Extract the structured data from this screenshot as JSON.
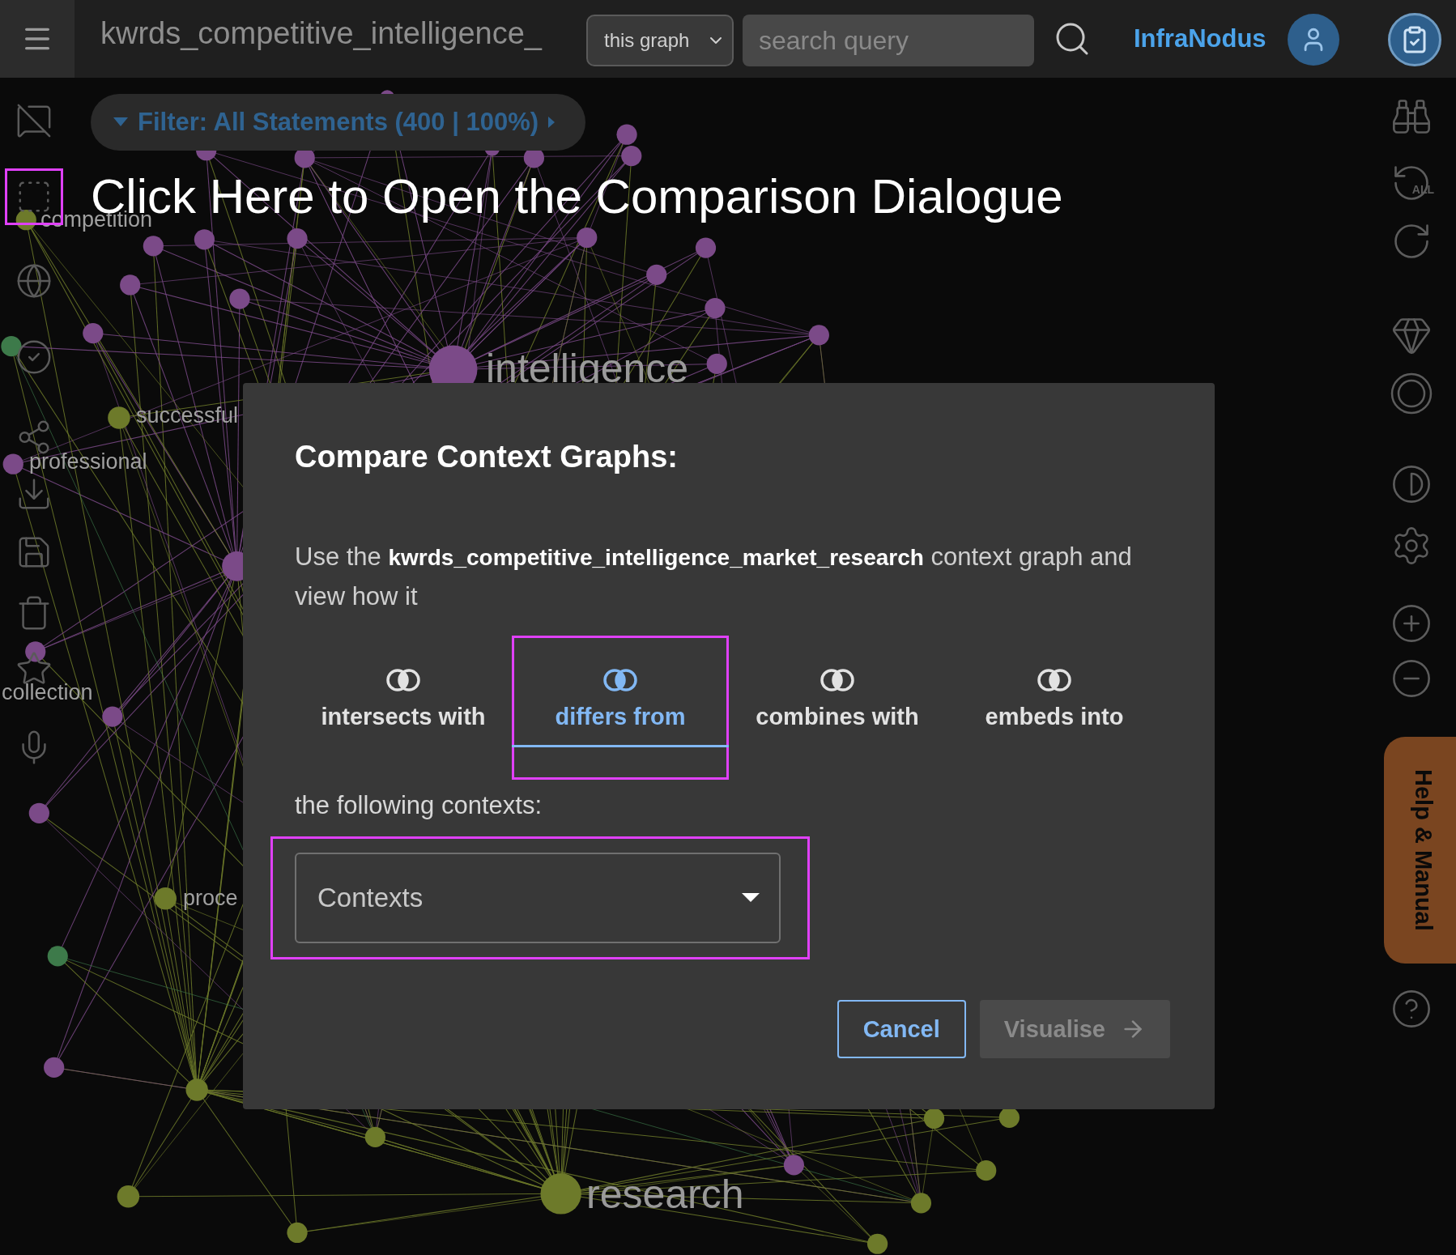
{
  "top_bar": {
    "title": "kwrds_competitive_intelligence_",
    "scope_select": {
      "value": "this graph"
    },
    "search": {
      "placeholder": "search query"
    },
    "brand": "InfraNodus"
  },
  "filter": {
    "label": "Filter: All Statements (400 | 100%)"
  },
  "caption": "Click Here to Open the Comparison Dialogue",
  "left_toolbar": [
    {
      "kind": "chat-off",
      "highlighted": false
    },
    {
      "kind": "selection",
      "highlighted": true
    },
    {
      "kind": "globe",
      "highlighted": false
    },
    {
      "kind": "check-circle",
      "highlighted": false
    },
    {
      "kind": "share",
      "highlighted": false
    },
    {
      "kind": "download",
      "highlighted": false
    },
    {
      "kind": "save",
      "highlighted": false
    },
    {
      "kind": "trash",
      "highlighted": false
    },
    {
      "kind": "star",
      "highlighted": false
    },
    {
      "kind": "mic",
      "highlighted": false
    }
  ],
  "right_toolbar": [
    {
      "kind": "binoculars"
    },
    {
      "kind": "reset",
      "label": "ALL"
    },
    {
      "kind": "refresh"
    },
    {
      "kind": "gem"
    },
    {
      "kind": "ring"
    },
    {
      "kind": "contrast"
    },
    {
      "kind": "settings"
    },
    {
      "kind": "zoom-in"
    },
    {
      "kind": "zoom-out"
    },
    {
      "kind": "help-tab",
      "label": "Help & Manual"
    },
    {
      "kind": "help"
    }
  ],
  "graph_labels": [
    {
      "text": "competition",
      "kind": "node"
    },
    {
      "text": "intelligence",
      "kind": "hub"
    },
    {
      "text": "successful",
      "kind": "node"
    },
    {
      "text": "professional",
      "kind": "node"
    },
    {
      "text": "collection",
      "kind": "node"
    },
    {
      "text": "proce",
      "kind": "node"
    },
    {
      "text": "research",
      "kind": "hub"
    }
  ],
  "dialog": {
    "title": "Compare Context Graphs:",
    "description": "Use the **kwrds_competitive_intelligence_market_research** context graph and view how it",
    "modes": [
      {
        "label": "intersects with",
        "selected": false,
        "highlighted": false
      },
      {
        "label": "differs from",
        "selected": true,
        "highlighted": true
      },
      {
        "label": "combines with",
        "selected": false,
        "highlighted": false
      },
      {
        "label": "embeds into",
        "selected": false,
        "highlighted": false
      }
    ],
    "contexts_label": "the following contexts:",
    "contexts_select": {
      "placeholder": "Contexts",
      "highlighted": true
    },
    "buttons": [
      {
        "label": "Cancel",
        "disabled": false,
        "kind": "outline"
      },
      {
        "label": "Visualise",
        "disabled": true,
        "kind": "primary"
      }
    ]
  }
}
